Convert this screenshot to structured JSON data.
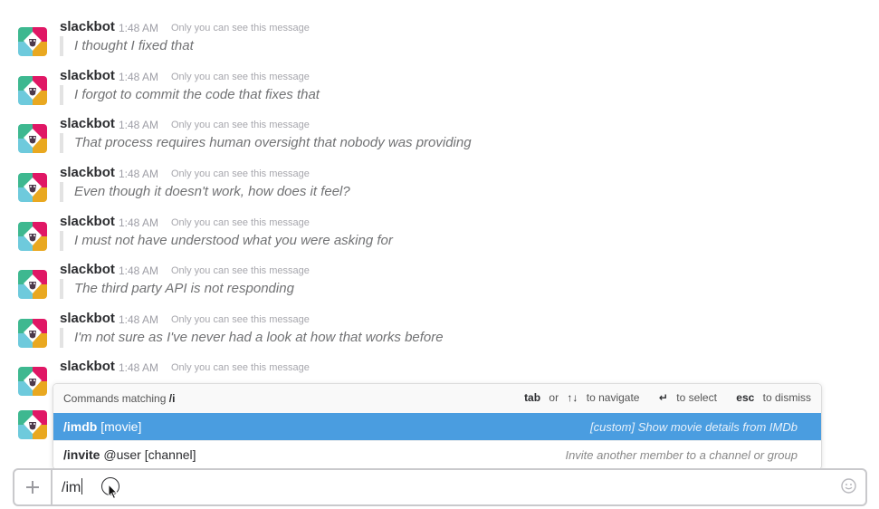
{
  "messages": [
    {
      "sender": "slackbot",
      "time": "1:48 AM",
      "note": "Only you can see this message",
      "text": "I thought I fixed that"
    },
    {
      "sender": "slackbot",
      "time": "1:48 AM",
      "note": "Only you can see this message",
      "text": "I forgot to commit the code that fixes that"
    },
    {
      "sender": "slackbot",
      "time": "1:48 AM",
      "note": "Only you can see this message",
      "text": "That process requires human oversight that nobody was providing"
    },
    {
      "sender": "slackbot",
      "time": "1:48 AM",
      "note": "Only you can see this message",
      "text": "Even though it doesn't work, how does it feel?"
    },
    {
      "sender": "slackbot",
      "time": "1:48 AM",
      "note": "Only you can see this message",
      "text": "I must not have understood what you were asking for"
    },
    {
      "sender": "slackbot",
      "time": "1:48 AM",
      "note": "Only you can see this message",
      "text": "The third party API is not responding"
    },
    {
      "sender": "slackbot",
      "time": "1:48 AM",
      "note": "Only you can see this message",
      "text": "I'm not sure as I've never had a look at how that works before"
    },
    {
      "sender": "slackbot",
      "time": "1:48 AM",
      "note": "Only you can see this message",
      "text": ""
    }
  ],
  "autocomplete": {
    "header_prefix": "Commands matching",
    "query": "/i",
    "hints": {
      "tab": "tab",
      "or": "or",
      "arrows": "↑↓",
      "navigate": "to navigate",
      "enter": "↵",
      "select": "to select",
      "esc": "esc",
      "dismiss": "to dismiss"
    },
    "commands": [
      {
        "name": "/imdb",
        "args": "[movie]",
        "description": "[custom] Show movie details from IMDb",
        "selected": true
      },
      {
        "name": "/invite",
        "args": "@user [channel]",
        "description": "Invite another member to a channel or group",
        "selected": false
      }
    ]
  },
  "composer": {
    "value": "/im",
    "plus_icon": "plus-icon",
    "emoji_icon": "emoji-icon"
  },
  "colors": {
    "highlight": "#4a9de0",
    "quote_bar": "#e3e3e3"
  }
}
